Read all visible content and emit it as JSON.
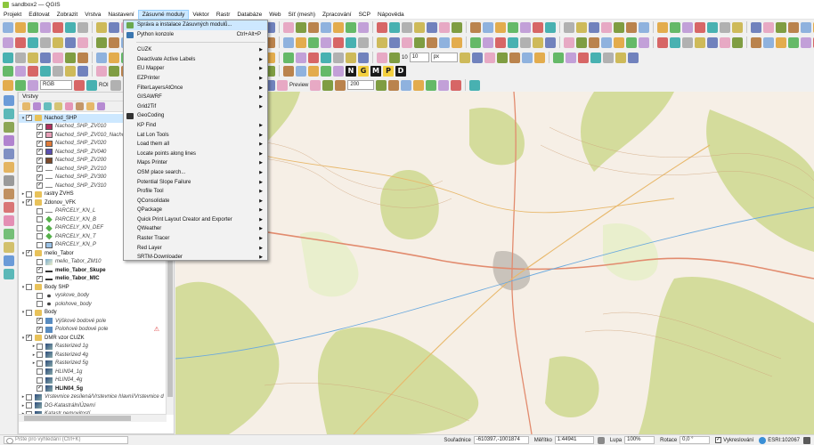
{
  "window": {
    "title": "sandbox2 — QGIS"
  },
  "menubar": [
    "Projekt",
    "Editovat",
    "Zobrazit",
    "Vrstva",
    "Nastavení",
    "Zásuvné moduly",
    "Vektor",
    "Rastr",
    "Databáze",
    "Web",
    "Síť (mesh)",
    "Zpracování",
    "SCP",
    "Nápověda"
  ],
  "menubar_active_index": 5,
  "plugins_menu": {
    "items": [
      {
        "label": "Správa a instalace Zásuvných modulů...",
        "shortcut": "",
        "submenu": false,
        "highlighted": true,
        "icon": "puzzle-icon"
      },
      {
        "label": "Python konzole",
        "shortcut": "Ctrl+Alt+P",
        "submenu": false,
        "highlighted": false,
        "icon": "python-icon"
      },
      {
        "label": "CUZK",
        "submenu": true
      },
      {
        "label": "Deactivate Active Labels",
        "submenu": true
      },
      {
        "label": "EU Mapper",
        "submenu": true
      },
      {
        "label": "EZPrinter",
        "submenu": true
      },
      {
        "label": "FilterLayersAtOnce",
        "submenu": true
      },
      {
        "label": "GISAWRF",
        "submenu": true
      },
      {
        "label": "Grid2Tif",
        "submenu": true
      },
      {
        "label": "GeoCoding",
        "submenu": false,
        "icon": "binoculars-icon"
      },
      {
        "label": "KP Find",
        "submenu": true
      },
      {
        "label": "Lat Lon Tools",
        "submenu": true
      },
      {
        "label": "Load them all",
        "submenu": true
      },
      {
        "label": "Locate points along lines",
        "submenu": true
      },
      {
        "label": "Maps Printer",
        "submenu": true
      },
      {
        "label": "OSM place search...",
        "submenu": true
      },
      {
        "label": "Potential Slope Failure",
        "submenu": true
      },
      {
        "label": "Profile Tool",
        "submenu": true
      },
      {
        "label": "QConsolidate",
        "submenu": true
      },
      {
        "label": "QPackage",
        "submenu": true
      },
      {
        "label": "Quick Print Layout Creator and Exporter",
        "submenu": true
      },
      {
        "label": "QWeather",
        "submenu": true
      },
      {
        "label": "Raster Tracer",
        "submenu": true
      },
      {
        "label": "Red Layer",
        "submenu": true
      },
      {
        "label": "SRTM-Downloader",
        "submenu": true
      }
    ]
  },
  "toolbars": {
    "snap_tolerance": "10",
    "snap_unit": "px",
    "raster_mode": "RGB",
    "roi_label": "ROI",
    "dist_label": "Dist",
    "dist_value": "0,010000",
    "min_label": "Min",
    "min_value": "60",
    "max_label": "Max",
    "max_value": "100",
    "preview_label": "Preview",
    "preview_value": "200",
    "big_letters": [
      "N",
      "G",
      "M",
      "P",
      "D"
    ]
  },
  "layers_panel": {
    "title": "Vrstvy",
    "tree": [
      {
        "indent": 0,
        "arrow": "▾",
        "checked": true,
        "label": "Nachod_SHP",
        "style": "",
        "selected": true,
        "symbol": "folder"
      },
      {
        "indent": 1,
        "arrow": "",
        "checked": true,
        "label": "Nachod_SHP_ZV010",
        "style": "italic",
        "symbol": "#b03060"
      },
      {
        "indent": 1,
        "arrow": "",
        "checked": true,
        "label": "Nachod_SHP_ZV010_Nachod",
        "style": "italic",
        "symbol": "#e8a0b8"
      },
      {
        "indent": 1,
        "arrow": "",
        "checked": true,
        "label": "Nachod_SHP_ZV020",
        "style": "italic",
        "symbol": "#e07b39"
      },
      {
        "indent": 1,
        "arrow": "",
        "checked": true,
        "label": "Nachod_SHP_ZV040",
        "style": "italic",
        "symbol": "#5a4fb0"
      },
      {
        "indent": 1,
        "arrow": "",
        "checked": true,
        "label": "Nachod_SHP_ZV200",
        "style": "italic",
        "symbol": "#7c4a2c"
      },
      {
        "indent": 1,
        "arrow": "",
        "checked": true,
        "label": "Nachod_SHP_ZV210",
        "style": "italic",
        "symbol": "line-gray"
      },
      {
        "indent": 1,
        "arrow": "",
        "checked": true,
        "label": "Nachod_SHP_ZV300",
        "style": "italic",
        "symbol": "line-gray"
      },
      {
        "indent": 1,
        "arrow": "",
        "checked": true,
        "label": "Nachod_SHP_ZV310",
        "style": "italic",
        "symbol": "line-gray"
      },
      {
        "indent": 0,
        "arrow": "▸",
        "checked": false,
        "label": "rastry ZVHS",
        "style": "",
        "symbol": "folder"
      },
      {
        "indent": 0,
        "arrow": "▾",
        "checked": true,
        "label": "Zdonov_VFK",
        "style": "",
        "symbol": "folder"
      },
      {
        "indent": 1,
        "arrow": "",
        "checked": false,
        "label": "PARCELY_KN_L",
        "style": "italic",
        "symbol": "line-gray"
      },
      {
        "indent": 1,
        "arrow": "",
        "checked": false,
        "label": "PARCELY_KN_B",
        "style": "italic",
        "symbol": "diamond-green"
      },
      {
        "indent": 1,
        "arrow": "",
        "checked": false,
        "label": "PARCELY_KN_DEF",
        "style": "italic",
        "symbol": "diamond-green"
      },
      {
        "indent": 1,
        "arrow": "",
        "checked": false,
        "label": "PARCELY_KN_T",
        "style": "italic",
        "symbol": "diamond-green"
      },
      {
        "indent": 1,
        "arrow": "",
        "checked": false,
        "label": "PARCELY_KN_P",
        "style": "italic",
        "symbol": "#9bc2e6"
      },
      {
        "indent": 0,
        "arrow": "▾",
        "checked": true,
        "label": "melio_Tabor",
        "style": "",
        "symbol": "folder"
      },
      {
        "indent": 1,
        "arrow": "",
        "checked": false,
        "label": "melio_Tabor_ZM10",
        "style": "italic",
        "symbol": "raster"
      },
      {
        "indent": 1,
        "arrow": "",
        "checked": true,
        "label": "melio_Tabor_Skupe",
        "style": "bold",
        "symbol": "line-dark"
      },
      {
        "indent": 1,
        "arrow": "",
        "checked": true,
        "label": "melio_Tabor_MIC",
        "style": "bold",
        "symbol": "line-dark"
      },
      {
        "indent": 0,
        "arrow": "▾",
        "checked": false,
        "label": "Body SHP",
        "style": "",
        "symbol": "folder"
      },
      {
        "indent": 1,
        "arrow": "",
        "checked": false,
        "label": "vyskove_body",
        "style": "italic",
        "symbol": "dot"
      },
      {
        "indent": 1,
        "arrow": "",
        "checked": false,
        "label": "polohove_body",
        "style": "italic",
        "symbol": "dot"
      },
      {
        "indent": 0,
        "arrow": "▾",
        "checked": false,
        "label": "Body",
        "style": "",
        "symbol": "folder"
      },
      {
        "indent": 1,
        "arrow": "",
        "checked": true,
        "label": "Výškové bodové pole",
        "style": "italic",
        "symbol": "point-group"
      },
      {
        "indent": 1,
        "arrow": "",
        "checked": true,
        "label": "Polohové bodové pole",
        "style": "italic",
        "symbol": "point-group",
        "warning": true
      },
      {
        "indent": 0,
        "arrow": "▾",
        "checked": true,
        "label": "DMR vzor CUZK",
        "style": "",
        "symbol": "folder"
      },
      {
        "indent": 1,
        "arrow": "▸",
        "checked": false,
        "label": "Rasterized 1g",
        "style": "italic",
        "symbol": "raster-dark"
      },
      {
        "indent": 1,
        "arrow": "▸",
        "checked": false,
        "label": "Rasterized 4g",
        "style": "italic",
        "symbol": "raster-dark"
      },
      {
        "indent": 1,
        "arrow": "▸",
        "checked": false,
        "label": "Rasterized 5g",
        "style": "italic",
        "symbol": "raster-dark"
      },
      {
        "indent": 1,
        "arrow": "",
        "checked": false,
        "label": "HLIN04_1g",
        "style": "italic",
        "symbol": "raster-dark"
      },
      {
        "indent": 1,
        "arrow": "",
        "checked": false,
        "label": "HLIN04_4g",
        "style": "italic",
        "symbol": "raster-dark"
      },
      {
        "indent": 1,
        "arrow": "",
        "checked": true,
        "label": "HLIN04_5g",
        "style": "bold",
        "symbol": "raster-dark"
      },
      {
        "indent": 0,
        "arrow": "▸",
        "checked": false,
        "label": "Vrstevnice zesílená/Vrstevnice hlavní/Vrstevnice d",
        "style": "italic",
        "symbol": "raster-dark"
      },
      {
        "indent": 0,
        "arrow": "▸",
        "checked": false,
        "label": "DG-KatastrálníÚzemí",
        "style": "italic",
        "symbol": "raster-dark"
      },
      {
        "indent": 0,
        "arrow": "▸",
        "checked": false,
        "label": "Katastr nemovitostí",
        "style": "italic",
        "symbol": "raster-dark"
      }
    ]
  },
  "statusbar": {
    "search_placeholder": "Pište pro vyhledání (Ctrl+K)",
    "coord_label": "Souřadnice",
    "coord_value": "-610397,-1001874",
    "scale_label": "Měřítko",
    "scale_value": "1:44941",
    "magnifier_label": "Lupa",
    "magnifier_value": "100%",
    "rotation_label": "Rotace",
    "rotation_value": "0,0 °",
    "render_label": "Vykreslování",
    "crs_label": "ESRI:102067"
  },
  "colors": {
    "menu_highlight": "#cde8ff",
    "map_forest": "#d8dea0",
    "map_field": "#f6efe6"
  }
}
